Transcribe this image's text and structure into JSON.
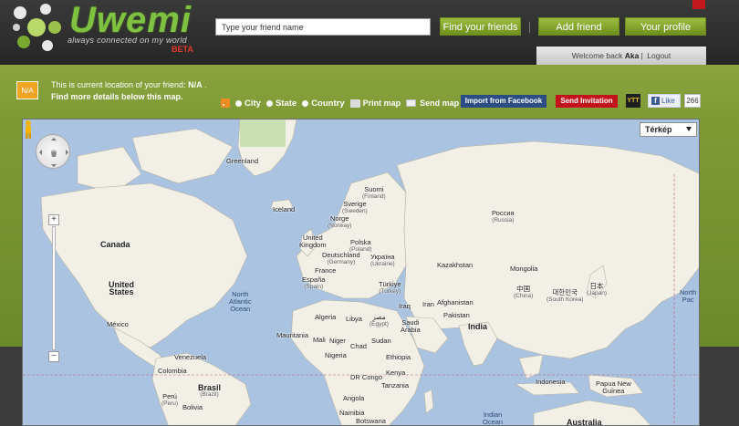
{
  "app": {
    "logo_text": "Uwemi",
    "tagline": "always connected on my world",
    "badge": "BETA"
  },
  "header": {
    "search_placeholder": "Type your friend name",
    "find_button": "Find your friends",
    "add_button": "Add friend",
    "profile_button": "Your profile",
    "welcome_prefix": "Welcome back",
    "username": "Aka",
    "separator": "|",
    "logout": "Logout"
  },
  "location": {
    "badge": "N/A",
    "line1_prefix": "This is current location of your friend:",
    "value": "N/A",
    "line1_suffix": ".",
    "line2": "Find more details below this map."
  },
  "options": {
    "city": "City",
    "state": "State",
    "country": "Country",
    "print": "Print map",
    "send": "Send map",
    "import_facebook": "Import from Facebook",
    "send_invitation": "Send Invitation",
    "ytt": "YTT",
    "like": "Like",
    "like_count": "266"
  },
  "map": {
    "type_selector": "Térkép",
    "labels": {
      "greenland": "Greenland",
      "iceland": "Iceland",
      "canada": "Canada",
      "usa_1": "United",
      "usa_2": "States",
      "mexico": "México",
      "north_atlantic_1": "North",
      "north_atlantic_2": "Atlantic",
      "north_atlantic_3": "Ocean",
      "venezuela": "Venezuela",
      "colombia": "Colombia",
      "brasil": "Brasil",
      "brasil_sub": "(Brazil)",
      "peru_1": "Perú",
      "peru_2": "(Peru)",
      "bolivia": "Bolivia",
      "suomi": "Suomi",
      "suomi_sub": "(Finland)",
      "sverige": "Sverige",
      "sverige_sub": "(Sweden)",
      "norge": "Norge",
      "norge_sub": "(Norway)",
      "uk_1": "United",
      "uk_2": "Kingdom",
      "polska": "Polska",
      "polska_sub": "(Poland)",
      "deutschland": "Deutschland",
      "deutschland_sub": "(Germany)",
      "ukraina": "Україна",
      "ukraina_sub": "(Ukraine)",
      "france": "France",
      "espana": "España",
      "espana_sub": "(Spain)",
      "turkiye": "Türkiye",
      "turkiye_sub": "(Turkey)",
      "russia": "Россия",
      "russia_sub": "(Russia)",
      "kazakhstan": "Kazakhstan",
      "mongolia": "Mongolia",
      "china": "中国",
      "china_sub": "(China)",
      "japan": "日本",
      "japan_sub": "(Japan)",
      "korea": "대한민국",
      "korea_sub": "(South Korea)",
      "iraq": "Iraq",
      "iran": "Iran",
      "afghanistan": "Afghanistan",
      "pakistan": "Pakistan",
      "india": "India",
      "algeria": "Algeria",
      "libya": "Libya",
      "egypt": "مصر",
      "egypt_sub": "(Egypt)",
      "saudi_1": "Saudi",
      "saudi_2": "Arabia",
      "mauritania": "Mauritania",
      "mali": "Mali",
      "niger": "Niger",
      "chad": "Chad",
      "sudan": "Sudan",
      "ethiopia": "Ethiopia",
      "nigeria": "Nigeria",
      "drc": "DR Congo",
      "kenya": "Kenya",
      "tanzania": "Tanzania",
      "angola": "Angola",
      "namibia": "Namibia",
      "botswana": "Botswana",
      "indian_ocean_1": "Indian",
      "indian_ocean_2": "Ocean",
      "indonesia": "Indonesia",
      "png_1": "Papua New",
      "png_2": "Guinea",
      "australia": "Australia",
      "north_pacific_1": "North",
      "north_pacific_2": "Pac"
    }
  }
}
